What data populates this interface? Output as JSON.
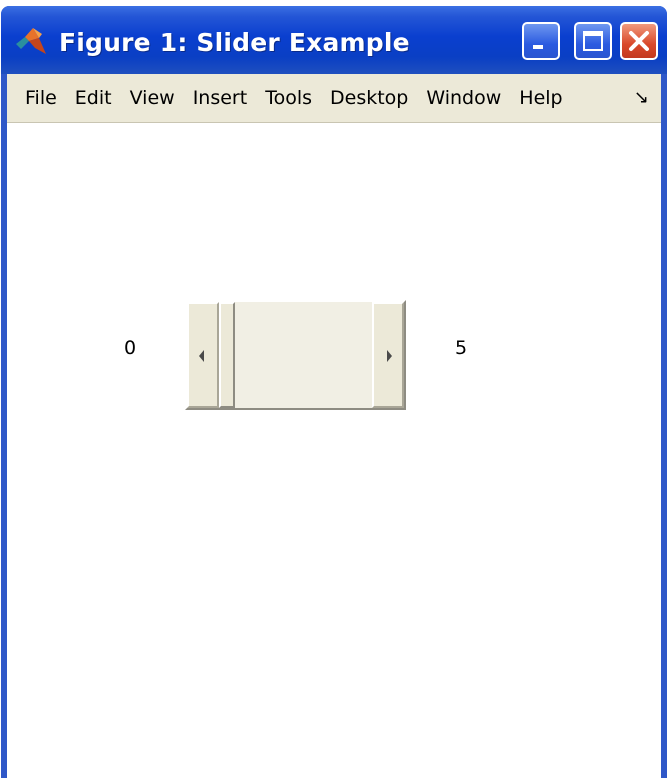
{
  "window": {
    "title": "Figure 1: Slider Example",
    "title_color": "#ffffff",
    "titlebar_color": "#0a3fcf",
    "app_icon": "matlab-logo-icon",
    "controls": {
      "minimize_icon": "minimize-icon",
      "maximize_icon": "maximize-icon",
      "close_icon": "close-icon"
    }
  },
  "menubar": {
    "items": [
      "File",
      "Edit",
      "View",
      "Insert",
      "Tools",
      "Desktop",
      "Window",
      "Help"
    ],
    "overflow_icon": "toolbar-dock-arrow-icon",
    "overflow_glyph": "↘"
  },
  "slider": {
    "min_label": "0",
    "max_label": "5",
    "min": 0,
    "max": 5,
    "value": 0,
    "left_arrow_icon": "left-arrow-icon",
    "right_arrow_icon": "right-arrow-icon"
  }
}
